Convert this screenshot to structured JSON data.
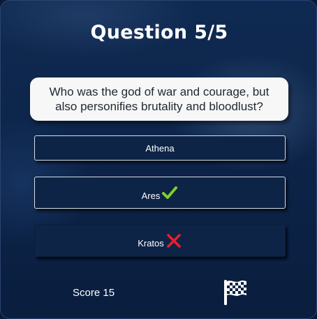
{
  "quiz": {
    "title": "Question 5/5",
    "question": "Who was the god of war and courage, but also personifies brutality and bloodlust?",
    "answers": [
      {
        "label": "Athena",
        "state": "neutral"
      },
      {
        "label": "Ares",
        "state": "correct",
        "icon": "check-icon"
      },
      {
        "label": "Kratos",
        "state": "wrong",
        "icon": "cross-icon"
      }
    ],
    "score_text": "Score 15",
    "finish_icon": "checkered-flag-icon"
  },
  "colors": {
    "background": "#0c2347",
    "correct": "#7ed321",
    "wrong": "#e8202a",
    "question_bg": "#f7f7f7"
  }
}
